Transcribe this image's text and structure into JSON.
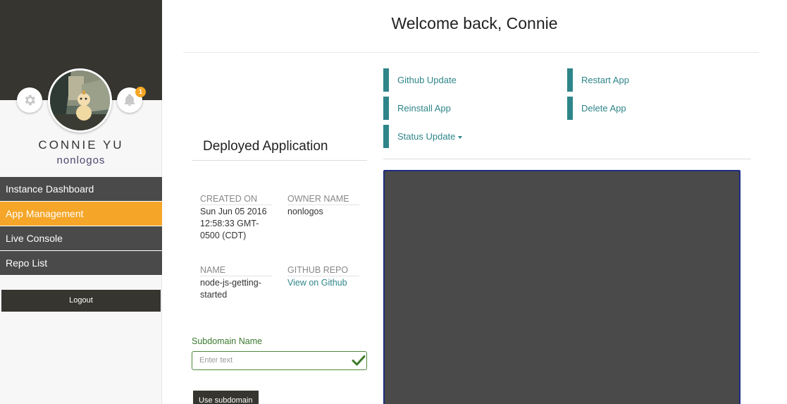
{
  "sidebar": {
    "user_name": "CONNIE YU",
    "user_handle": "nonlogos",
    "notification_count": "1",
    "nav": [
      {
        "label": "Instance Dashboard",
        "active": false
      },
      {
        "label": "App Management",
        "active": true
      },
      {
        "label": "Live Console",
        "active": false
      },
      {
        "label": "Repo List",
        "active": false
      }
    ],
    "logout_label": "Logout"
  },
  "header": {
    "welcome": "Welcome back, Connie"
  },
  "deployed": {
    "title": "Deployed Application",
    "created_on_label": "CREATED ON",
    "created_on_value": "Sun Jun 05 2016 12:58:33 GMT-0500 (CDT)",
    "owner_label": "OWNER NAME",
    "owner_value": "nonlogos",
    "name_label": "NAME",
    "name_value": "node-js-getting-started",
    "repo_label": "GITHUB REPO",
    "repo_link": "View on Github"
  },
  "subdomain": {
    "label": "Subdomain Name",
    "placeholder": "Enter text",
    "button_label": "Use subdomain"
  },
  "actions": {
    "github_update": "Github Update",
    "reinstall_app": "Reinstall App",
    "status_update": "Status Update",
    "restart_app": "Restart App",
    "delete_app": "Delete App"
  },
  "colors": {
    "sidebar_dark": "#373530",
    "nav_bg": "#4a4a4a",
    "nav_active": "#f5a628",
    "accent_teal": "#2e8589",
    "success_green": "#4e8a3c",
    "console_bg": "#4a4a4a",
    "console_border": "#1e2c82"
  },
  "icons": {
    "settings": "gear-icon",
    "notifications": "bell-icon",
    "valid": "checkmark-icon",
    "dropdown": "caret-down-icon"
  }
}
